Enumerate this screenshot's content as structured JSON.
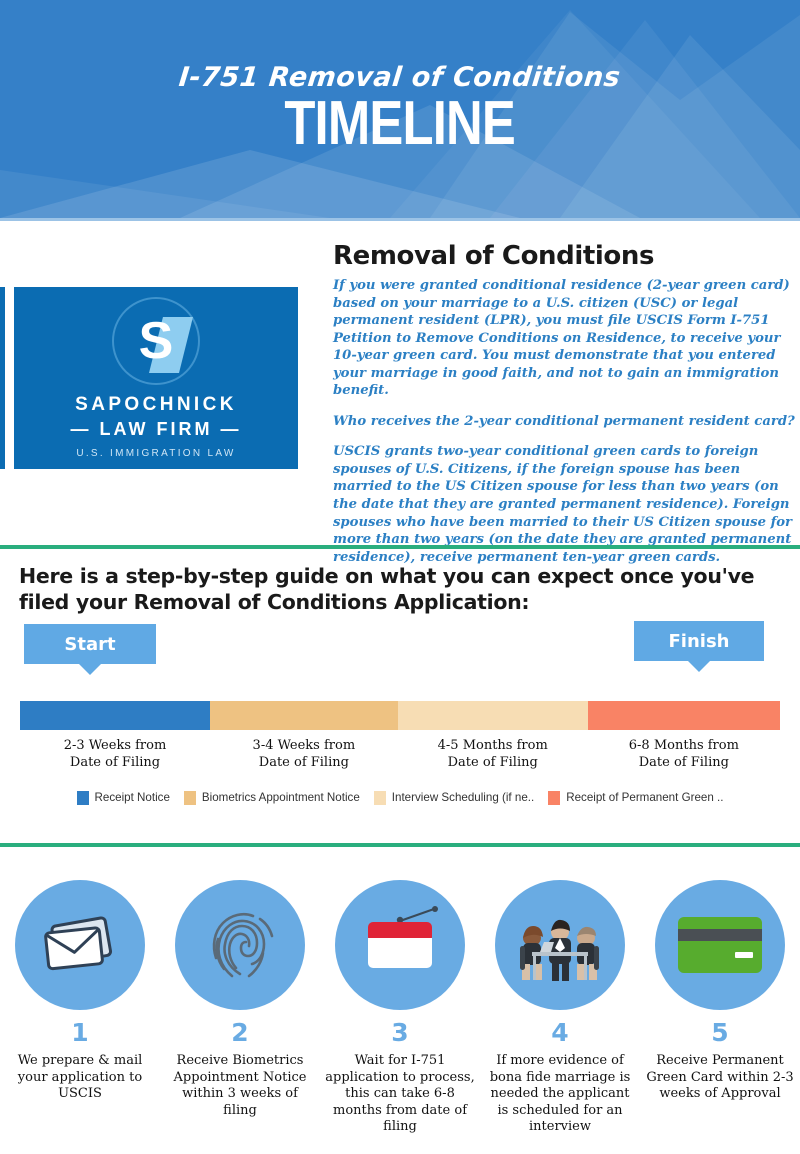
{
  "header": {
    "kicker": "I-751 Removal of Conditions",
    "title": "TIMELINE",
    "background_color": "#3580c8"
  },
  "logo": {
    "monogram": "S",
    "name": "SAPOCHNICK",
    "subname": "— LAW FIRM —",
    "tagline": "U.S. IMMIGRATION LAW",
    "background_color": "#0b6cb2"
  },
  "intro": {
    "heading": "Removal of Conditions",
    "paragraphs": [
      "If you were granted conditional residence (2-year green card) based on your marriage to a U.S. citizen (USC) or legal permanent resident (LPR), you must file USCIS Form I-751 Petition to Remove Conditions on Residence, to receive your 10-year green card. You must demonstrate that you entered your marriage in good faith, and not to gain an immigration benefit.",
      "Who receives the 2-year conditional permanent resident card?",
      "USCIS grants two-year conditional green cards to foreign spouses of U.S. Citizens, if the foreign spouse has been married to the US Citizen spouse for less than two years (on the date that they are granted permanent residence). Foreign spouses who have been married to their US Citizen spouse for more than two years (on the date they are granted permanent residence), receive permanent ten-year green cards."
    ],
    "text_color": "#2c80c4"
  },
  "timeline": {
    "heading": "Here is a step-by-step guide on what you can expect once you've filed your Removal of Conditions Application:",
    "start_label": "Start",
    "finish_label": "Finish",
    "bubble_color": "#60a9e4",
    "divider_color": "#2aae7e"
  },
  "chart_data": {
    "type": "bar",
    "title": "I-751 Removal of Conditions Timeline",
    "orientation": "horizontal-stacked",
    "categories": [
      "Receipt Notice",
      "Biometrics Appointment Notice",
      "Interview Scheduling (if ne..",
      "Receipt of Permanent Green .."
    ],
    "segment_labels": [
      "2-3 Weeks from\nDate of Filing",
      "3-4 Weeks from\nDate of Filing",
      "4-5 Months from\nDate of Filing",
      "6-8 Months from\nDate of Filing"
    ],
    "segment_label_lines": [
      [
        "2-3 Weeks from",
        "Date of Filing"
      ],
      [
        "3-4 Weeks from",
        "Date of Filing"
      ],
      [
        "4-5 Months from",
        "Date of Filing"
      ],
      [
        "6-8 Months from",
        "Date of Filing"
      ]
    ],
    "values": [
      25,
      24.7,
      25,
      25.3
    ],
    "colors": [
      "#2e7dc4",
      "#eec282",
      "#f7ddb4",
      "#f98365"
    ],
    "legend": {
      "position": "bottom",
      "entries": [
        {
          "label": "Receipt Notice",
          "color": "#2e7dc4"
        },
        {
          "label": "Biometrics Appointment Notice",
          "color": "#eec282"
        },
        {
          "label": "Interview Scheduling (if ne..",
          "color": "#f7ddb4"
        },
        {
          "label": "Receipt of Permanent Green ..",
          "color": "#f98365"
        }
      ]
    },
    "xlabel": "",
    "ylabel": "",
    "grid": false
  },
  "steps": [
    {
      "number": "1",
      "icon": "envelope-icon",
      "caption": "We prepare & mail your application to USCIS"
    },
    {
      "number": "2",
      "icon": "fingerprint-icon",
      "caption": "Receive Biometrics Appointment Notice within 3 weeks of filing"
    },
    {
      "number": "3",
      "icon": "calendar-icon",
      "caption": "Wait for I-751 application to process, this can take 6-8 months from date of filing"
    },
    {
      "number": "4",
      "icon": "interview-meeting-icon",
      "caption": "If more evidence of bona fide marriage is needed the applicant is scheduled for an interview"
    },
    {
      "number": "5",
      "icon": "green-card-icon",
      "caption": "Receive Permanent Green Card within 2-3 weeks of Approval"
    }
  ]
}
